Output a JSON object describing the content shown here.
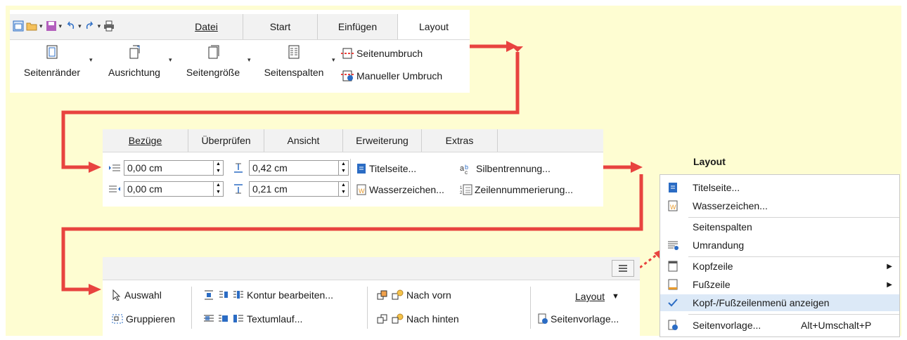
{
  "colors": {
    "background": "#fefdd2",
    "arrow": "#e8433f",
    "tabbar": "#f2f2f2",
    "accent_blue": "#2b6cc4"
  },
  "quick_access": {
    "icons": [
      "window-icon",
      "open-folder-icon",
      "save-icon",
      "undo-icon",
      "redo-icon",
      "print-icon"
    ]
  },
  "panel1": {
    "tabs": [
      "Datei",
      "Start",
      "Einfügen",
      "Layout"
    ],
    "active_tab": "Layout",
    "buttons": [
      {
        "label": "Seitenränder",
        "icon": "margins-icon"
      },
      {
        "label": "Ausrichtung",
        "icon": "orientation-icon"
      },
      {
        "label": "Seitengröße",
        "icon": "page-size-icon"
      },
      {
        "label": "Seitenspalten",
        "icon": "columns-icon"
      }
    ],
    "break_items": [
      {
        "label": "Seitenumbruch",
        "icon": "page-break-icon"
      },
      {
        "label": "Manueller Umbruch",
        "icon": "manual-break-icon"
      }
    ]
  },
  "panel2": {
    "tabs": [
      "Bezüge",
      "Überprüfen",
      "Ansicht",
      "Erweiterung",
      "Extras"
    ],
    "indent_fields": [
      {
        "value": "0,00 cm",
        "icon": "indent-before-icon"
      },
      {
        "value": "0,00 cm",
        "icon": "indent-after-icon"
      }
    ],
    "spacing_fields": [
      {
        "value": "0,42 cm",
        "icon": "spacing-above-icon"
      },
      {
        "value": "0,21 cm",
        "icon": "spacing-below-icon"
      }
    ],
    "items": [
      {
        "label": "Titelseite...",
        "icon": "title-page-icon"
      },
      {
        "label": "Silbentrennung...",
        "icon": "hyphenation-icon"
      },
      {
        "label": "Wasserzeichen...",
        "icon": "watermark-icon"
      },
      {
        "label": "Zeilennummerierung...",
        "icon": "line-numbering-icon"
      }
    ]
  },
  "panel3": {
    "menu_button_icon": "hamburger-icon",
    "items": [
      {
        "label": "Auswahl",
        "icon": "select-icon"
      },
      {
        "label": "Gruppieren",
        "icon": "group-icon"
      },
      {
        "label": "Kontur bearbeiten...",
        "icon": "contour-icon"
      },
      {
        "label": "Textumlauf...",
        "icon": "wrap-icon"
      },
      {
        "label": "Nach vorn",
        "icon": "bring-forward-icon"
      },
      {
        "label": "Nach hinten",
        "icon": "send-backward-icon"
      },
      {
        "label": "Layout",
        "icon": "dropdown-icon"
      },
      {
        "label": "Seitenvorlage...",
        "icon": "page-style-icon"
      }
    ]
  },
  "layout_menu": {
    "title": "Layout",
    "items": [
      {
        "label": "Titelseite...",
        "icon": "title-page-icon",
        "submenu": false
      },
      {
        "label": "Wasserzeichen...",
        "icon": "watermark-icon",
        "submenu": false
      },
      {
        "label": "Seitenspalten",
        "icon": "",
        "submenu": false
      },
      {
        "label": "Umrandung",
        "icon": "border-icon",
        "submenu": false
      },
      {
        "label": "Kopfzeile",
        "icon": "header-icon",
        "submenu": true
      },
      {
        "label": "Fußzeile",
        "icon": "footer-icon",
        "submenu": true
      },
      {
        "label": "Kopf-/Fußzeilenmenü anzeigen",
        "icon": "check-icon",
        "submenu": false,
        "checked": true
      },
      {
        "label": "Seitenvorlage...",
        "icon": "page-style-icon",
        "submenu": false,
        "shortcut": "Alt+Umschalt+P"
      }
    ]
  }
}
